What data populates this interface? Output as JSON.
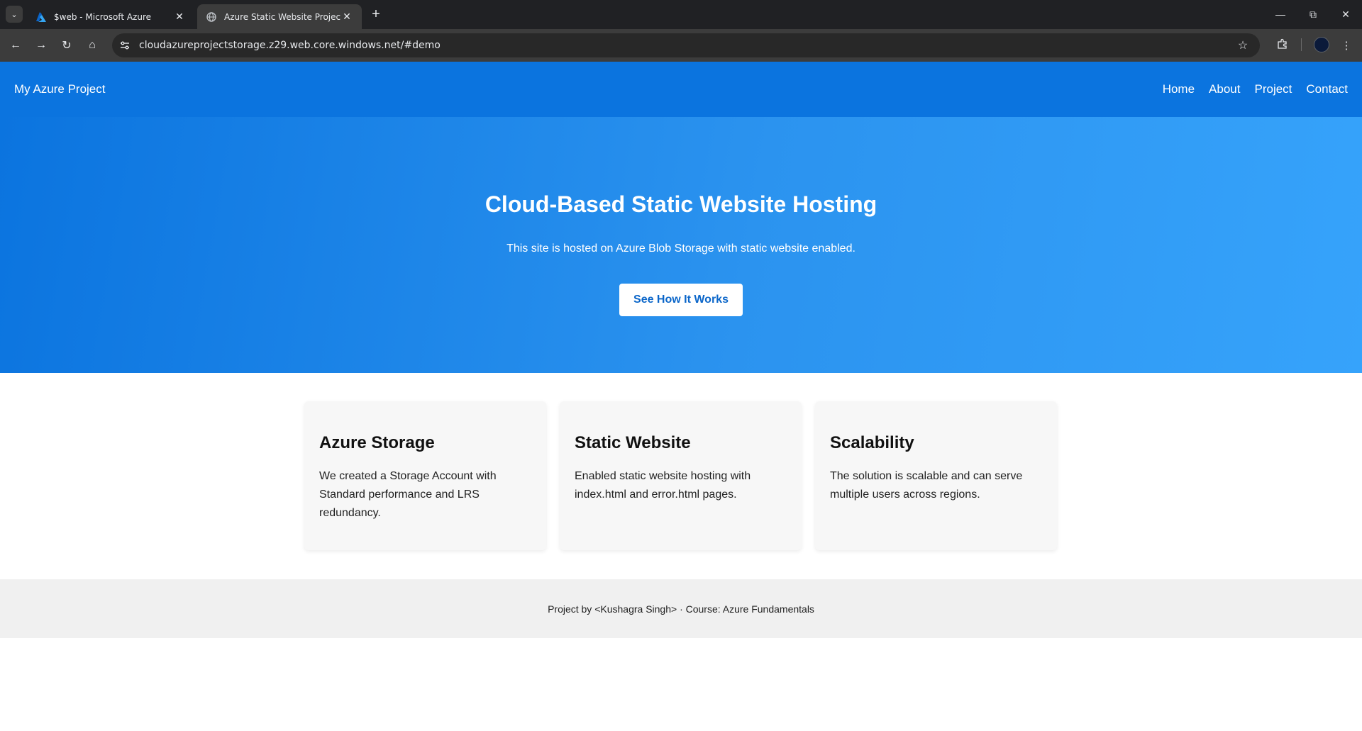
{
  "browser": {
    "tabs": [
      {
        "title": "$web - Microsoft Azure",
        "icon": "azure-logo-icon",
        "active": false
      },
      {
        "title": "Azure Static Website Project",
        "icon": "globe-icon",
        "active": true
      }
    ],
    "url": "cloudazureprojectstorage.z29.web.core.windows.net/#demo"
  },
  "site": {
    "brand": "My Azure Project",
    "nav": [
      "Home",
      "About",
      "Project",
      "Contact"
    ],
    "colors": {
      "header": "#0b74df",
      "hero_start": "#0b74df",
      "hero_end": "#36a3fb",
      "button_text": "#0b66c9"
    }
  },
  "hero": {
    "title": "Cloud-Based Static Website Hosting",
    "subtitle": "This site is hosted on Azure Blob Storage with static website enabled.",
    "cta": "See How It Works"
  },
  "cards": [
    {
      "title": "Azure Storage",
      "text": "We created a Storage Account with Standard performance and LRS redundancy."
    },
    {
      "title": "Static Website",
      "text": "Enabled static website hosting with index.html and error.html pages."
    },
    {
      "title": "Scalability",
      "text": "The solution is scalable and can serve multiple users across regions."
    }
  ],
  "footer": {
    "text": "Project by <Kushagra Singh> · Course: Azure Fundamentals"
  }
}
